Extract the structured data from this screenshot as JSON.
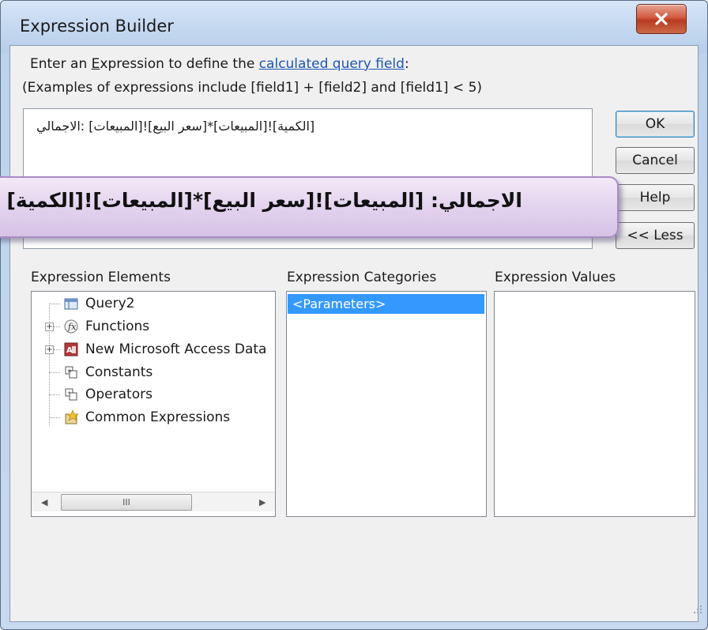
{
  "window": {
    "title": "Expression Builder",
    "close_label": "close"
  },
  "prompt": {
    "line1_pre": "Enter an ",
    "line1_e": "E",
    "line1_mid": "xpression to define the ",
    "line1_link": "calculated query field",
    "line1_post": ":",
    "line2": "(Examples of expressions include [field1] + [field2] and [field1] < 5)"
  },
  "expression": {
    "value": "[الكمية]![المبيعات]*[سعر البيع]![المبيعات] :الاجمالي"
  },
  "callout": {
    "text": "الاجمالي: [المبيعات]![سعر البيع]*[المبيعات]![الكمية]"
  },
  "buttons": {
    "ok": "OK",
    "cancel": "Cancel",
    "help": "Help",
    "less": "<< Less"
  },
  "elements": {
    "header": "Expression Elements",
    "items": [
      "Query2",
      "Functions",
      "New Microsoft Access Data",
      "Constants",
      "Operators",
      "Common Expressions"
    ],
    "scroll_thumb": "III"
  },
  "categories": {
    "header": "Expression Categories",
    "items": [
      "<Parameters>"
    ]
  },
  "values": {
    "header": "Expression Values"
  },
  "icons": {
    "query": "query-icon",
    "functions": "function-icon",
    "database": "database-icon",
    "constants": "constants-icon",
    "operators": "operators-icon",
    "common": "common-expressions-icon"
  },
  "colors": {
    "selection": "#3399ff",
    "link": "#1a56b8",
    "close": "#c64a2f",
    "callout": "#e3d3ee"
  }
}
